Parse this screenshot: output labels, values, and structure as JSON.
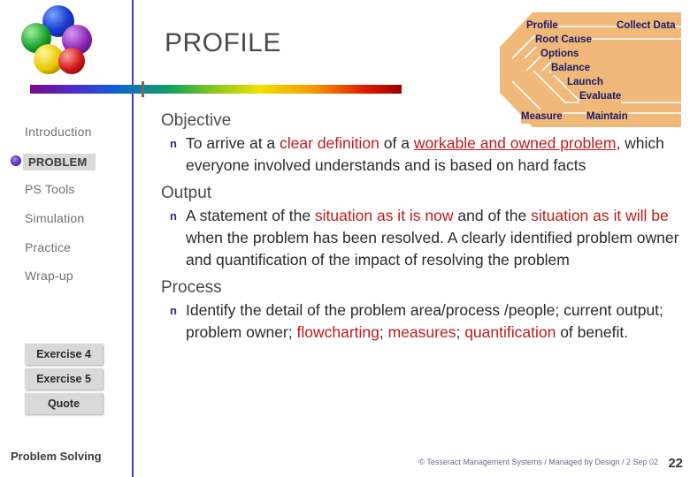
{
  "slide": {
    "title": "PROFILE",
    "footer_label": "Problem Solving",
    "credit": "© Tesseract Management Systems / Managed by Design / 2 Sep 02",
    "page_number": "22"
  },
  "sidebar": {
    "items": [
      {
        "label": "Introduction",
        "active": false
      },
      {
        "label": "PROBLEM",
        "active": true
      },
      {
        "label": "PS Tools",
        "active": false
      },
      {
        "label": "Simulation",
        "active": false
      },
      {
        "label": "Practice",
        "active": false
      },
      {
        "label": "Wrap-up",
        "active": false
      }
    ],
    "boxes": [
      {
        "label": "Exercise 4"
      },
      {
        "label": "Exercise 5"
      },
      {
        "label": "Quote"
      }
    ]
  },
  "process_diagram": {
    "steps": [
      "Profile",
      "Collect Data",
      "Root Cause",
      "Options",
      "Balance",
      "Launch",
      "Evaluate",
      "Measure",
      "Maintain"
    ],
    "labels": {
      "profile": "Profile",
      "collect_data": "Collect Data",
      "root_cause": "Root Cause",
      "options": "Options",
      "balance": "Balance",
      "launch": "Launch",
      "evaluate": "Evaluate",
      "measure": "Measure",
      "maintain": "Maintain"
    }
  },
  "content": {
    "sections": [
      {
        "heading": "Objective",
        "bullet_mark": "n",
        "parts": [
          {
            "text": "To arrive at a ",
            "style": "plain"
          },
          {
            "text": "clear definition",
            "style": "red"
          },
          {
            "text": " of a ",
            "style": "plain"
          },
          {
            "text": "workable and owned problem",
            "style": "red-underline"
          },
          {
            "text": ", which everyone involved understands and is based on hard facts",
            "style": "plain"
          }
        ]
      },
      {
        "heading": "Output",
        "bullet_mark": "n",
        "parts": [
          {
            "text": "A statement of the ",
            "style": "plain"
          },
          {
            "text": "situation as it is now",
            "style": "red"
          },
          {
            "text": " and of the ",
            "style": "plain"
          },
          {
            "text": "situation as it will be",
            "style": "red"
          },
          {
            "text": " when the problem has been resolved. A clearly identified problem owner and quantification of the impact of resolving the problem",
            "style": "plain"
          }
        ]
      },
      {
        "heading": "Process",
        "bullet_mark": "n",
        "parts": [
          {
            "text": "Identify the detail of the problem area/process /people; current output; problem owner; ",
            "style": "plain"
          },
          {
            "text": "flowcharting",
            "style": "red"
          },
          {
            "text": "; ",
            "style": "plain"
          },
          {
            "text": "measures",
            "style": "red"
          },
          {
            "text": "; ",
            "style": "plain"
          },
          {
            "text": "quantification",
            "style": "red"
          },
          {
            "text": " of benefit.",
            "style": "plain"
          }
        ]
      }
    ]
  },
  "colors": {
    "accent_red": "#c01a1a",
    "heading_gray": "#4a4a4a",
    "sidebar_rule": "#3a3ad0",
    "chevron_fill": "#f0b97a",
    "chevron_text": "#1a1a6a"
  }
}
